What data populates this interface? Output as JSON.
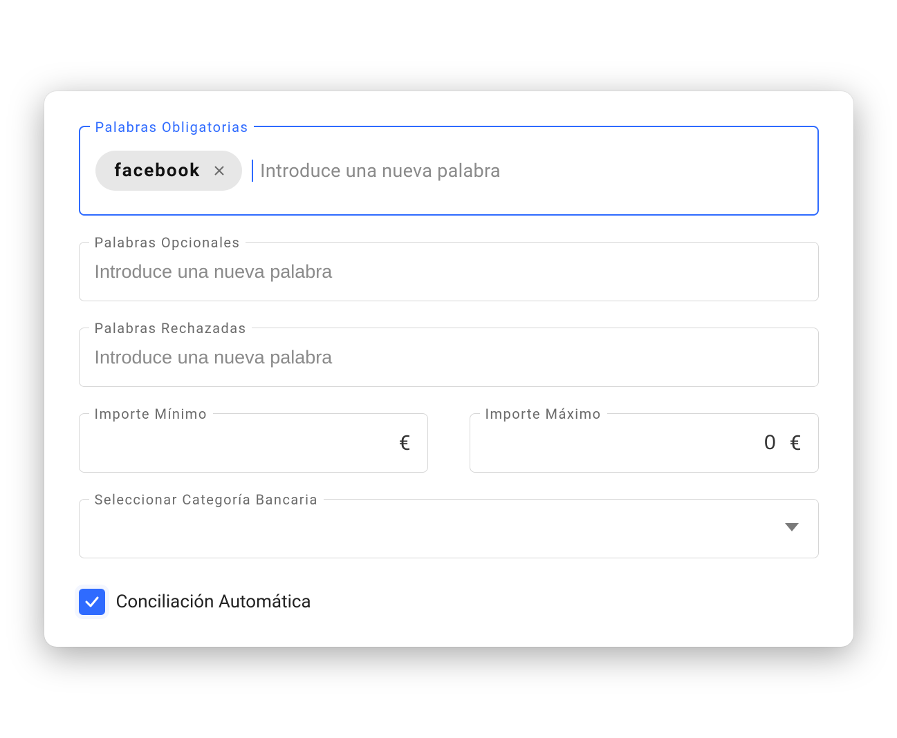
{
  "fields": {
    "mandatory": {
      "label": "Palabras Obligatorias",
      "chips": [
        "facebook"
      ],
      "placeholder": "Introduce una nueva palabra"
    },
    "optional": {
      "label": "Palabras Opcionales",
      "placeholder": "Introduce una nueva palabra"
    },
    "rejected": {
      "label": "Palabras Rechazadas",
      "placeholder": "Introduce una nueva palabra"
    },
    "min_amount": {
      "label": "Importe Mínimo",
      "value": "",
      "currency": "€"
    },
    "max_amount": {
      "label": "Importe Máximo",
      "value": "0",
      "currency": "€"
    },
    "bank_category": {
      "label": "Seleccionar Categoría Bancaria",
      "value": ""
    },
    "auto_reconcile": {
      "label": "Conciliación Automática",
      "checked": true
    }
  }
}
